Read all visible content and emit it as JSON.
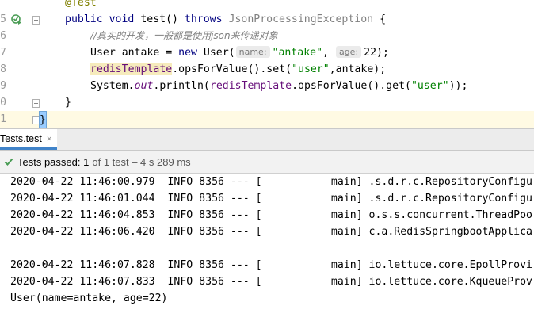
{
  "editor": {
    "lines": [
      {
        "num": "",
        "annotation": "@Test"
      },
      {
        "num": "5",
        "kw_public": "public",
        "kw_void": "void",
        "method": "test()",
        "kw_throws": "throws",
        "exception": "JsonProcessingException",
        "brace": "{"
      },
      {
        "num": "6",
        "comment": "//真实的开发，一般都是使用json来传递对象"
      },
      {
        "num": "7",
        "text_a": "User antake = ",
        "kw_new": "new",
        "text_b": " User(",
        "hint_name": "name:",
        "str_name": "\"antake\"",
        "text_c": ", ",
        "hint_age": "age:",
        "text_d": "22);"
      },
      {
        "num": "8",
        "field": "redisTemplate",
        "text_a": ".opsForValue().set(",
        "str_key": "\"user\"",
        "text_b": ",antake);"
      },
      {
        "num": "9",
        "text_a": "System.",
        "field_out": "out",
        "text_b": ".println(",
        "field": "redisTemplate",
        "text_c": ".opsForValue().get(",
        "str_key": "\"user\"",
        "text_d": "));"
      },
      {
        "num": "0",
        "brace": "}"
      },
      {
        "num": "1",
        "brace": "}"
      }
    ]
  },
  "tab": {
    "label": "Tests.test",
    "close": "×"
  },
  "status": {
    "check_icon": "check-icon",
    "passed_label": "Tests passed:",
    "passed_count": "1",
    "of_text": "of 1 test – 4 s 289 ms"
  },
  "console": {
    "lines": [
      "2020-04-22 11:46:00.979  INFO 8356 --- [           main] .s.d.r.c.RepositoryConfigu",
      "2020-04-22 11:46:01.044  INFO 8356 --- [           main] .s.d.r.c.RepositoryConfigu",
      "2020-04-22 11:46:04.853  INFO 8356 --- [           main] o.s.s.concurrent.ThreadPoo",
      "2020-04-22 11:46:06.420  INFO 8356 --- [           main] c.a.RedisSpringbootApplica",
      "",
      "2020-04-22 11:46:07.828  INFO 8356 --- [           main] io.lettuce.core.EpollProvi",
      "2020-04-22 11:46:07.833  INFO 8356 --- [           main] io.lettuce.core.KqueueProv",
      "User(name=antake, age=22)"
    ]
  },
  "colors": {
    "keyword": "#000080",
    "string": "#008000",
    "field": "#660e7a",
    "comment": "#808080",
    "pass": "#499c54",
    "tab_underline": "#4083c9"
  }
}
